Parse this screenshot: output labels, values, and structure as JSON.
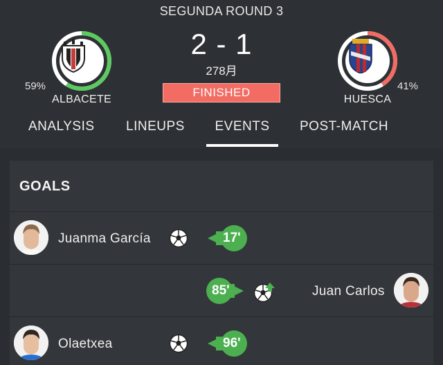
{
  "match": {
    "round": "SEGUNDA ROUND 3",
    "score": "2 - 1",
    "minute": "278月",
    "status": "FINISHED"
  },
  "home": {
    "name": "ALBACETE",
    "possession": "59%",
    "ring_fraction": 0.59,
    "ring_color": "#5ccb5f"
  },
  "away": {
    "name": "HUESCA",
    "possession": "41%",
    "ring_fraction": 0.41,
    "ring_color": "#f26c63"
  },
  "tabs": [
    "ANALYSIS",
    "LINEUPS",
    "EVENTS",
    "POST-MATCH"
  ],
  "active_tab": "EVENTS",
  "goals": {
    "title": "GOALS",
    "events": [
      {
        "player": "Juanma García",
        "minute": "17'",
        "side": "home",
        "icon": "soccer-ball-icon"
      },
      {
        "player": "Juan Carlos",
        "minute": "85'",
        "side": "away",
        "icon": "soccer-ball-own-goal-icon"
      },
      {
        "player": "Olaetxea",
        "minute": "96'",
        "side": "home",
        "icon": "soccer-ball-icon"
      }
    ]
  },
  "colors": {
    "accent_green": "#5ccb5f",
    "accent_red": "#f26c63",
    "background": "#2a2d31",
    "card": "#33363a"
  }
}
